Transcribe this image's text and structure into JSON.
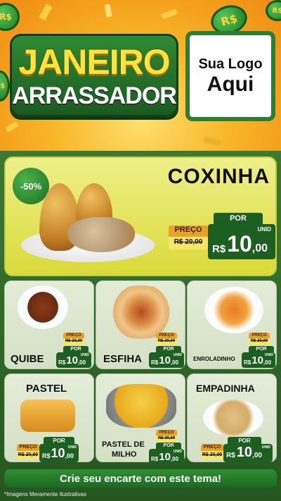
{
  "header": {
    "title_line1": "JANEIRO",
    "title_line2": "ARRASSADOR",
    "logo_line1": "Sua Logo",
    "logo_line2": "Aqui",
    "coin_text": "R$"
  },
  "feature": {
    "discount": "-50%",
    "name": "COXINHA",
    "por": "POR",
    "preco_label": "PREÇO",
    "old_price": "R$ 20,00",
    "currency": "R$",
    "price_int": "10",
    "price_dec": ",00",
    "unit": "UNID"
  },
  "cards": [
    {
      "name": "QUIBE",
      "preco_label": "PREÇO",
      "old_price": "R$ 20,00",
      "por": "POR",
      "currency": "R$",
      "price_int": "10",
      "price_dec": ",00",
      "unit": "UNID"
    },
    {
      "name": "ESFIHA",
      "preco_label": "PREÇO",
      "old_price": "R$ 20,00",
      "por": "POR",
      "currency": "R$",
      "price_int": "10",
      "price_dec": ",00",
      "unit": "UNID"
    },
    {
      "name": "ENROLADINHO",
      "preco_label": "PREÇO",
      "old_price": "R$ 20,00",
      "por": "POR",
      "currency": "R$",
      "price_int": "10",
      "price_dec": ",00",
      "unit": "UNID"
    },
    {
      "name": "PASTEL",
      "preco_label": "PREÇO",
      "old_price": "R$ 20,00",
      "por": "POR",
      "currency": "R$",
      "price_int": "10",
      "price_dec": ",00",
      "unit": "UNID"
    },
    {
      "name_line1": "PASTEL DE",
      "name_line2": "MILHO",
      "preco_label": "PREÇO",
      "old_price": "R$ 20,00",
      "por": "POR",
      "currency": "R$",
      "price_int": "10",
      "price_dec": ",00",
      "unit": "UNID"
    },
    {
      "name": "EMPADINHA",
      "preco_label": "PREÇO",
      "old_price": "R$ 20,00",
      "por": "POR",
      "currency": "R$",
      "price_int": "10",
      "price_dec": ",00",
      "unit": "UNID"
    }
  ],
  "banner": "Crie seu encarte com este tema!",
  "footnote": "*Imagens Meramente Ilustrativas",
  "colors": {
    "brand_green": "#1d5e21",
    "accent_yellow": "#ffe23a",
    "orange": "#f08a12"
  }
}
